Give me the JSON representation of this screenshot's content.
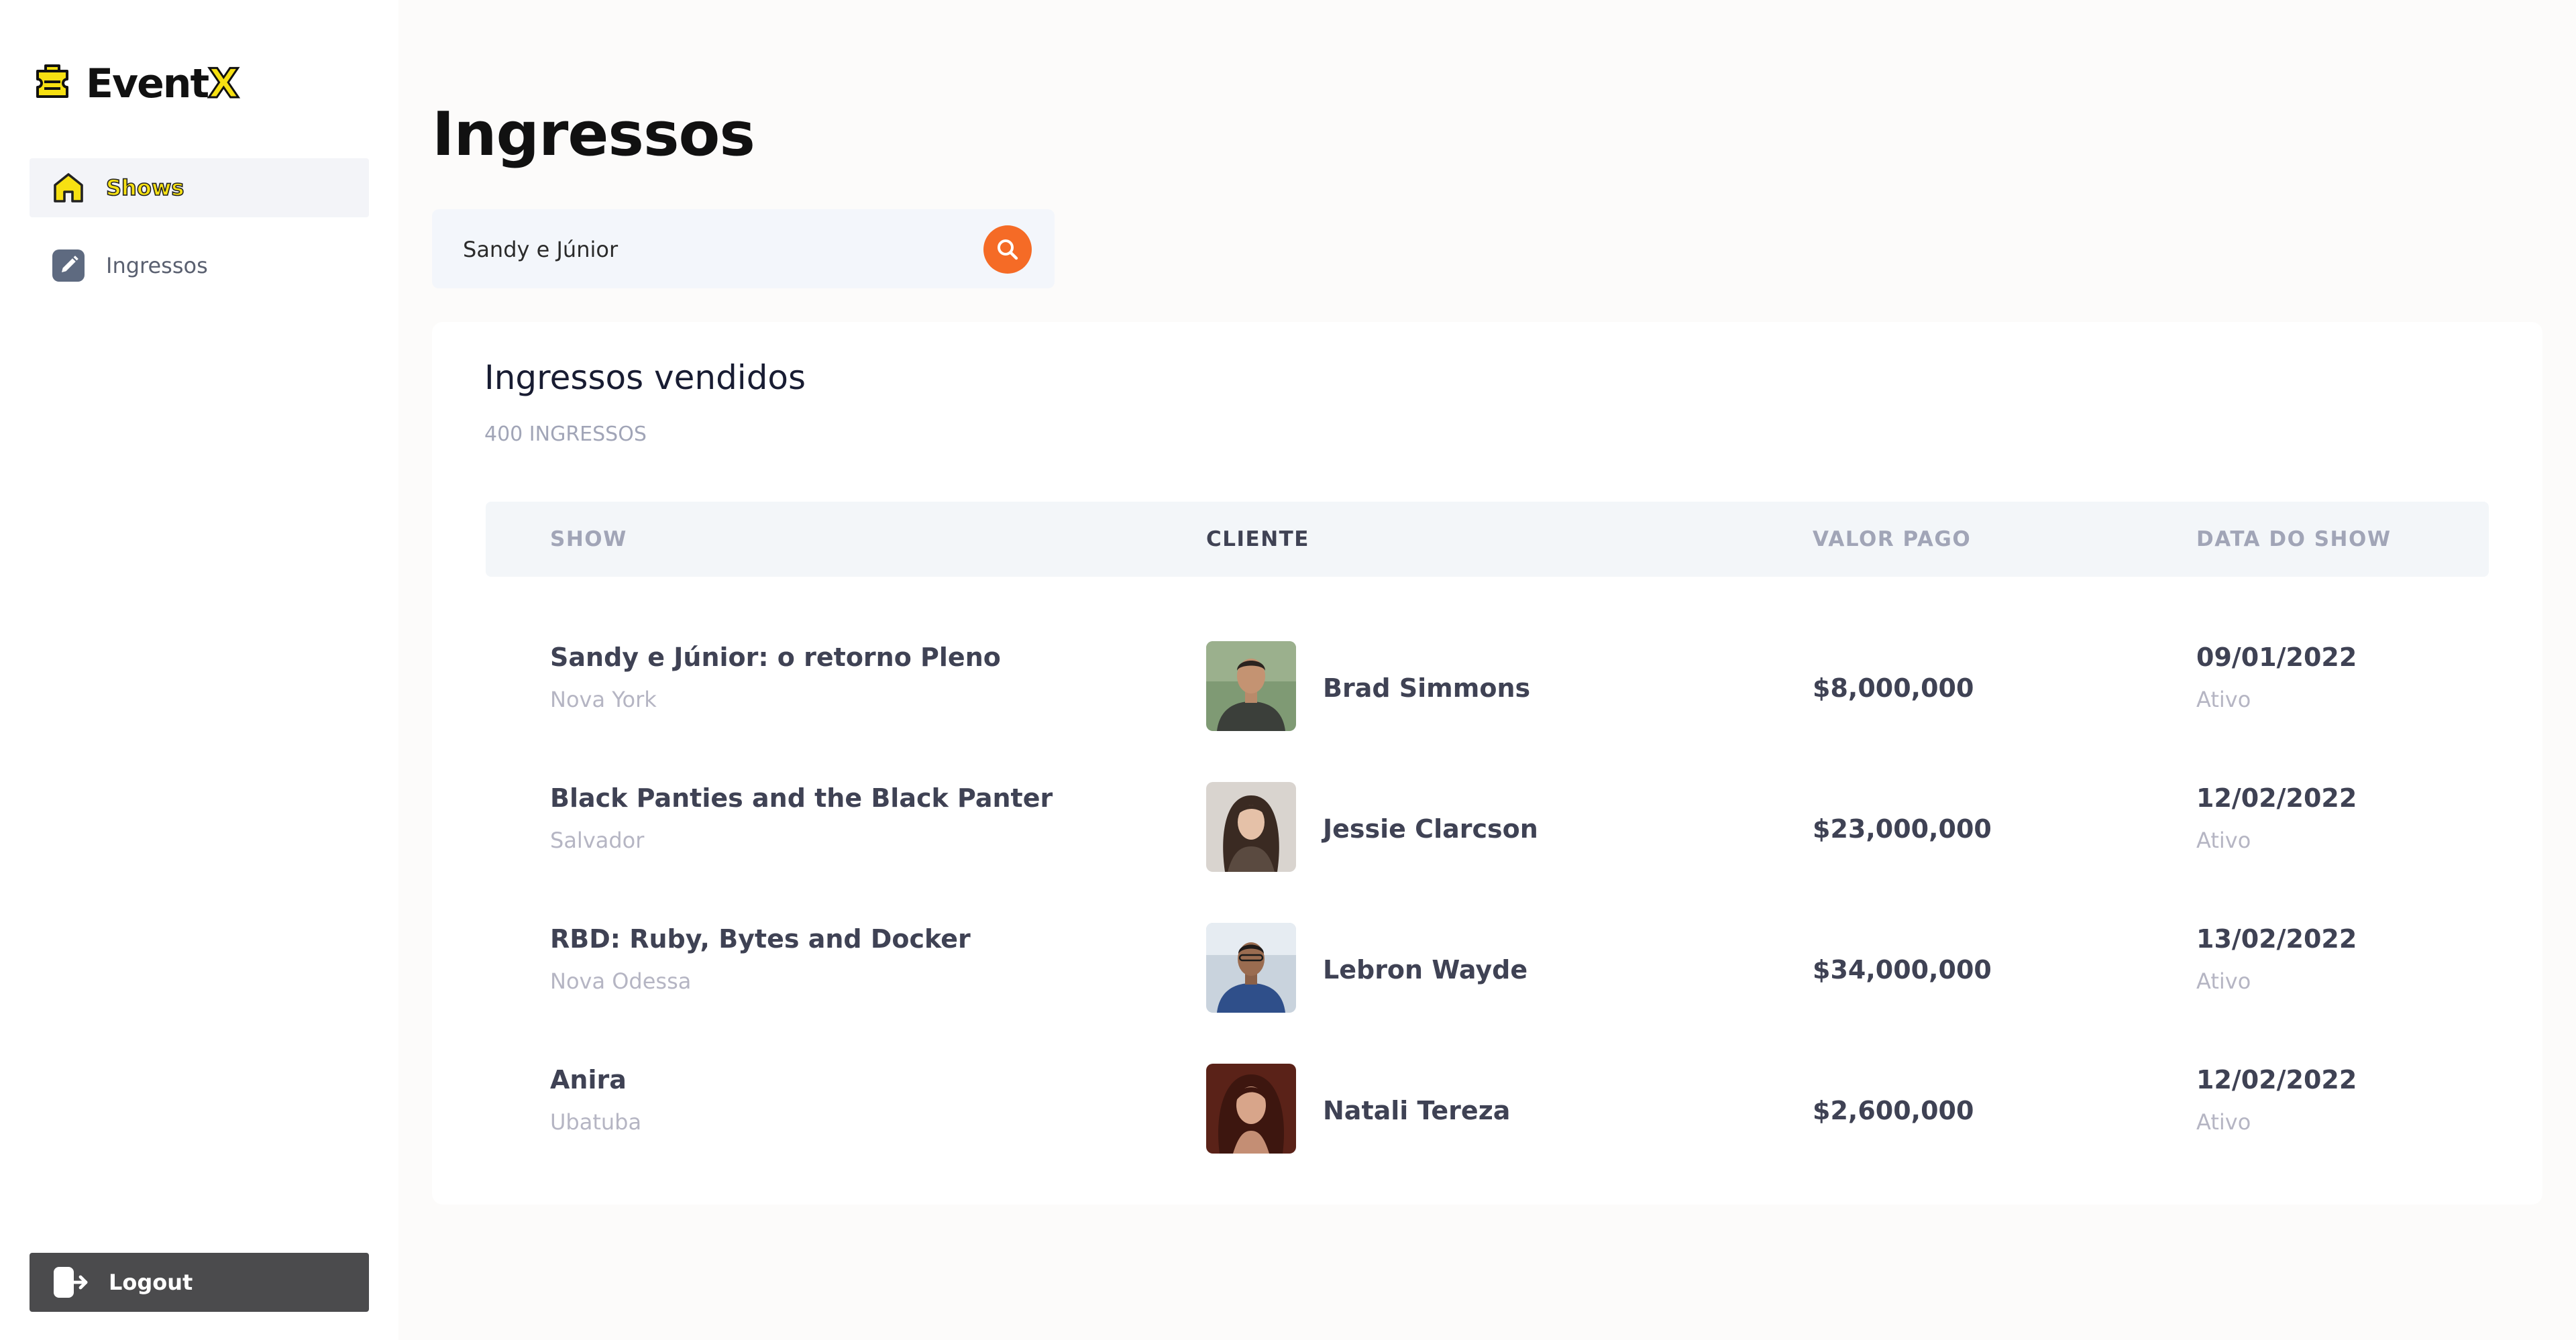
{
  "brand": {
    "name_main": "Event",
    "name_accent": "X"
  },
  "sidebar": {
    "items": [
      {
        "label": "Shows",
        "icon": "home-icon",
        "active": true
      },
      {
        "label": "Ingressos",
        "icon": "edit-icon",
        "active": false
      }
    ],
    "logout_label": "Logout"
  },
  "page": {
    "title": "Ingressos"
  },
  "search": {
    "value": "Sandy e Júnior",
    "placeholder": ""
  },
  "card": {
    "title": "Ingressos vendidos",
    "subtitle": "400 INGRESSOS",
    "columns": [
      "SHOW",
      "CLIENTE",
      "VALOR PAGO",
      "DATA DO SHOW"
    ],
    "rows": [
      {
        "show": "Sandy e Júnior: o retorno Pleno",
        "city": "Nova York",
        "client": "Brad Simmons",
        "value": "$8,000,000",
        "date": "09/01/2022",
        "status": "Ativo"
      },
      {
        "show": "Black Panties and the Black Panter",
        "city": "Salvador",
        "client": "Jessie Clarcson",
        "value": "$23,000,000",
        "date": "12/02/2022",
        "status": "Ativo"
      },
      {
        "show": "RBD: Ruby, Bytes and Docker",
        "city": "Nova Odessa",
        "client": "Lebron Wayde",
        "value": "$34,000,000",
        "date": "13/02/2022",
        "status": "Ativo"
      },
      {
        "show": "Anira",
        "city": "Ubatuba",
        "client": "Natali Tereza",
        "value": "$2,600,000",
        "date": "12/02/2022",
        "status": "Ativo"
      }
    ]
  },
  "colors": {
    "brand_accent": "#f6e012",
    "search_button": "#f56b26",
    "logout_bg": "#4b4b4d",
    "active_nav_bg": "#f3f4f8"
  }
}
